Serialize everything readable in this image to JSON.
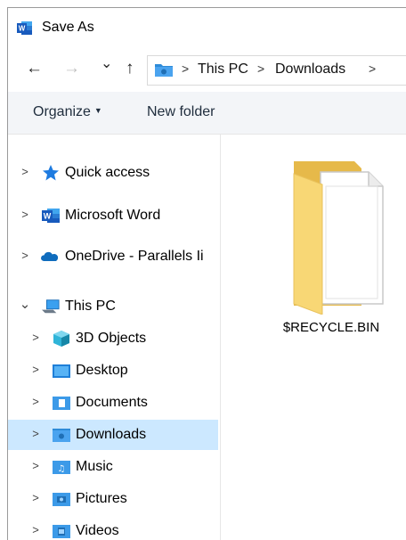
{
  "window": {
    "title": "Save As",
    "app_icon": "word-icon"
  },
  "nav": {
    "back": "←",
    "forward": "→",
    "recent": "⌄",
    "up": "↑",
    "address": {
      "folder_icon": "downloads-folder-icon",
      "crumbs": [
        "This PC",
        "Downloads"
      ]
    }
  },
  "toolbar": {
    "organize": "Organize",
    "new_folder": "New folder"
  },
  "tree": [
    {
      "label": "Quick access",
      "icon": "star-icon",
      "expanded": false
    },
    {
      "label": "Microsoft Word",
      "icon": "word-icon",
      "expanded": false
    },
    {
      "label": "OneDrive - Parallels Ii",
      "icon": "onedrive-icon",
      "expanded": false
    },
    {
      "label": "This PC",
      "icon": "computer-icon",
      "expanded": true
    },
    {
      "label": "3D Objects",
      "icon": "3d-objects-icon"
    },
    {
      "label": "Desktop",
      "icon": "desktop-icon"
    },
    {
      "label": "Documents",
      "icon": "documents-icon"
    },
    {
      "label": "Downloads",
      "icon": "downloads-icon",
      "selected": true
    },
    {
      "label": "Music",
      "icon": "music-icon"
    },
    {
      "label": "Pictures",
      "icon": "pictures-icon"
    },
    {
      "label": "Videos",
      "icon": "videos-icon"
    }
  ],
  "files": [
    {
      "name": "$RECYCLE.BIN",
      "icon": "folder-icon"
    }
  ],
  "colors": {
    "selected": "#cce8ff",
    "folder": "#f8d775",
    "accent": "#0078d4"
  }
}
